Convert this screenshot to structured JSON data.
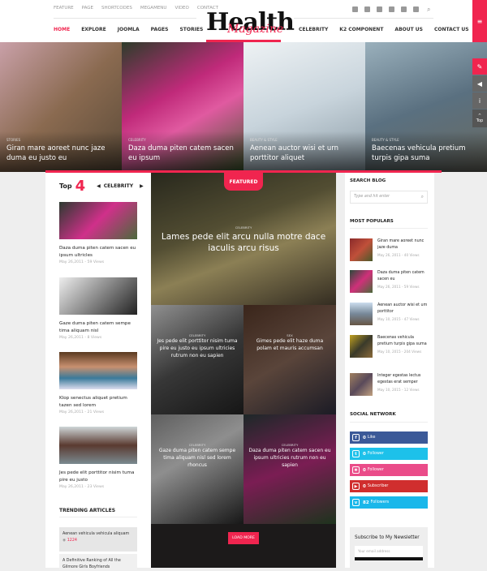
{
  "header": {
    "top_nav": [
      "FEATURE",
      "PAGE",
      "SHORTCODES",
      "MEGAMENU",
      "VIDEO",
      "CONTACT"
    ],
    "main_nav_left": [
      {
        "label": "HOME",
        "active": true
      },
      {
        "label": "EXPLORE"
      },
      {
        "label": "JOOMLA"
      },
      {
        "label": "PAGES"
      },
      {
        "label": "STORIES"
      }
    ],
    "main_nav_right": [
      "CELEBRITY",
      "K2 COMPONENT",
      "ABOUT US",
      "CONTACT US"
    ],
    "logo": {
      "word": "Health",
      "script": "Magazine"
    },
    "social_icons": [
      "facebook-icon",
      "twitter-icon",
      "youtube-icon",
      "google-plus-icon",
      "instagram-icon",
      "flickr-icon"
    ],
    "accent": "#f0254f"
  },
  "hero": [
    {
      "category": "STORIES",
      "title": "Giran mare aoreet nunc jaze duma eu justo eu"
    },
    {
      "category": "CELEBRITY",
      "title": "Daza duma piten catem sacen eu ipsum"
    },
    {
      "category": "BEAUTY & STYLE",
      "title": "Aenean auctor wisi et urn porttitor aliquet"
    },
    {
      "category": "BEAUTY & STYLE",
      "title": "Baecenas vehicula pretium turpis gipa suma"
    }
  ],
  "side_tools": {
    "top_label": "Top"
  },
  "top4": {
    "label": "Top",
    "number": "4",
    "category": "CELEBRITY",
    "items": [
      {
        "title": "Daza duma piten catem sacen eu ipsum ultricles",
        "meta": "May 26,2011 - 59 Views"
      },
      {
        "title": "Gaze duma piten catem sempe tima aliquam nisl",
        "meta": "May 26,2011 - 8 Views"
      },
      {
        "title": "Klop senectus aliquet pretium tazen sed lorem",
        "meta": "May 26,2011 - 21 Views"
      },
      {
        "title": "Jes pede elit porttitor nisim tuma pire eu justo",
        "meta": "May 26,2011 - 23 Views"
      }
    ]
  },
  "trending": {
    "heading": "TRENDING ARTICLES",
    "items": [
      {
        "title": "Aenean vehicula vehicula aliquam",
        "views": "1224"
      },
      {
        "title": "A Definitive Ranking of All the Gilmore Girls Boyfriends"
      }
    ]
  },
  "featured": {
    "badge": "FEATURED",
    "main": {
      "category": "CELEBRITY",
      "title": "Lames pede elit arcu nulla motre dace iaculis arcu risus"
    },
    "tiles": [
      {
        "category": "CELEBRITY",
        "title": "Jes pede elit porttitor nisim tuma pire eu justo eu ipsum ultricies rutrum non eu sapien"
      },
      {
        "category": "SEX",
        "title": "Gimes pede elit haze duma polam et mauris accumsan"
      },
      {
        "category": "CELEBRITY",
        "title": "Gaze duma piten catem sempe tima aliquam nisl sed lorem rhoncus"
      },
      {
        "category": "CELEBRITY",
        "title": "Daza duma piten catem sacen eu ipsum ultricies rutrum non eu sapien"
      }
    ],
    "load_more": "LOAD MORE"
  },
  "sidebar": {
    "search_heading": "SEARCH BLOG",
    "search_placeholder": "Type and hit enter",
    "popular_heading": "MOST POPULARS",
    "popular": [
      {
        "title": "Giran mare aoreet nunc jaze duma",
        "meta": "May 26, 2011 - 40 Views"
      },
      {
        "title": "Daza duma piten catem sacen eu",
        "meta": "May 26, 2011 - 59 Views"
      },
      {
        "title": "Aenean auctor wisi et um porttitor",
        "meta": "May 10, 2015 - 47 Views"
      },
      {
        "title": "Baecenas vehicula pretium turpis gipa suma",
        "meta": "May 10, 2015 - 204 Views"
      },
      {
        "title": "Integer egestas lectus egestas erat semper",
        "meta": "May 10, 2015 - 12 Views"
      }
    ],
    "social_heading": "SOCIAL NETWORK",
    "social": [
      {
        "count": "0",
        "label": "Like",
        "color": "#3b5998",
        "icon": "f"
      },
      {
        "count": "0",
        "label": "Follower",
        "color": "#1dc1ea",
        "icon": "t"
      },
      {
        "count": "0",
        "label": "Follower",
        "color": "#ea4c89",
        "icon": "✺"
      },
      {
        "count": "0",
        "label": "Subscriber",
        "color": "#d02e2e",
        "icon": "▶"
      },
      {
        "count": "82",
        "label": "Followers",
        "color": "#1ab7ea",
        "icon": "v"
      }
    ],
    "newsletter_heading": "Subscribe to My Newsletter",
    "email_placeholder": "Your email address"
  }
}
